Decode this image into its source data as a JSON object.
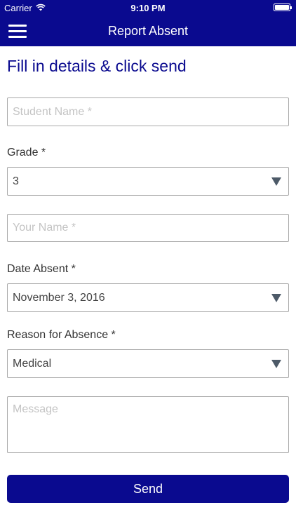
{
  "status_bar": {
    "carrier": "Carrier",
    "time": "9:10 PM"
  },
  "nav": {
    "title": "Report Absent"
  },
  "form": {
    "heading": "Fill in details & click send",
    "student_name_placeholder": "Student Name *",
    "grade_label": "Grade *",
    "grade_value": "3",
    "your_name_placeholder": "Your Name *",
    "date_label": "Date Absent *",
    "date_value": "November 3, 2016",
    "reason_label": "Reason for Absence *",
    "reason_value": "Medical",
    "message_placeholder": "Message",
    "send_label": "Send"
  },
  "colors": {
    "brand": "#0a0a8f",
    "border": "#a9a9a9",
    "arrow": "#4d5a68"
  }
}
